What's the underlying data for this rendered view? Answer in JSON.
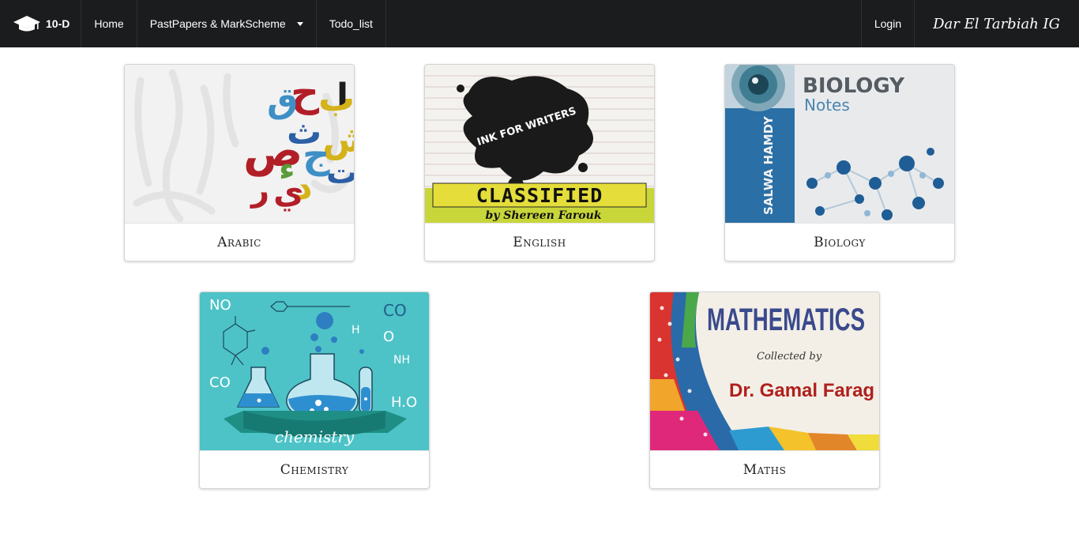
{
  "navbar": {
    "brand": "10-D",
    "brand_icon": "graduation-cap-icon",
    "home": "Home",
    "pastpapers": "PastPapers & MarkScheme",
    "todo": "Todo_list",
    "login": "Login",
    "school": "Dar El Tarbiah IG"
  },
  "subjects": [
    {
      "label": "Arabic"
    },
    {
      "label": "English"
    },
    {
      "label": "Biology"
    },
    {
      "label": "Chemistry"
    },
    {
      "label": "Maths"
    }
  ],
  "covers": {
    "english": {
      "title": "CLASSIFIED",
      "badge": "INK FOR WRITERS",
      "author": "by Shereen Farouk"
    },
    "biology": {
      "title": "BIOLOGY",
      "subtitle": "Notes",
      "author": "SALWA HAMDY"
    },
    "chemistry": {
      "banner": "chemistry",
      "f1": "NO",
      "f2": "CO",
      "f3": "H",
      "f4": "O",
      "f5": "NH",
      "f6": "CO",
      "f7": "H.O"
    },
    "maths": {
      "title": "MATHEMATICS",
      "collected": "Collected by",
      "author": "Dr. Gamal Farag"
    }
  },
  "colors": {
    "navbar_bg": "#1b1c1d",
    "chem_bg": "#4dc3c7",
    "maths_title": "#3a4a8c",
    "maths_author": "#b0201c"
  }
}
